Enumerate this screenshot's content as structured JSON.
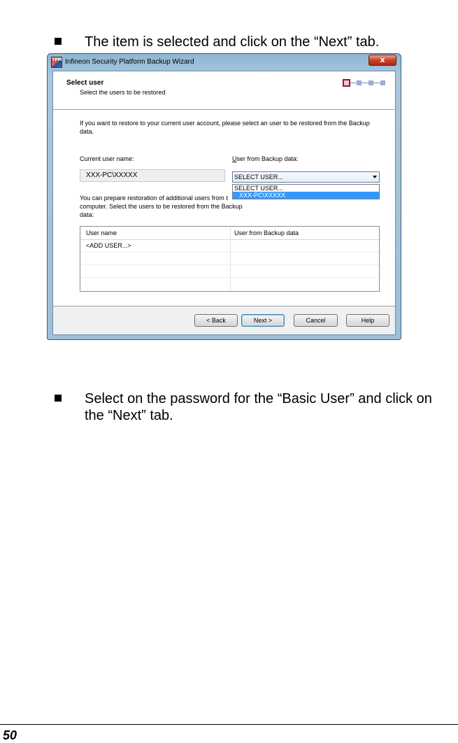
{
  "bullets": [
    "The item is selected and click on the “Next” tab.",
    "Select on the password for the “Basic User” and click on the “Next” tab."
  ],
  "wizard": {
    "title": "Infineon Security Platform Backup Wizard",
    "app_icon_text": "TPM",
    "close_label": "x",
    "header_title": "Select user",
    "header_subtitle": "Select the users to be restored",
    "intro_text": "If you want to restore to your current user account, please select an user to be restored from the Backup data.",
    "current_user_label": "Current user name:",
    "current_user_value": "XXX-PC\\XXXXX",
    "backup_user_label_rest": "ser from Backup data:",
    "backup_user_label_first": "U",
    "combo_value": "SELECT USER...",
    "dropdown_options": [
      "SELECT USER...",
      "XXX-PC\\XXXXX"
    ],
    "additional_text_line1": "You can prepare restoration of additional users from t",
    "additional_text_line2": "computer. Select the users to be restored from the Backup data:",
    "grid_headers": [
      "User name",
      "User from Backup data"
    ],
    "grid_rows": [
      "<ADD USER...>",
      "",
      "",
      ""
    ],
    "buttons": {
      "back": "< Back",
      "next": "Next >",
      "cancel": "Cancel",
      "help": "Help"
    }
  },
  "page_number": "50"
}
